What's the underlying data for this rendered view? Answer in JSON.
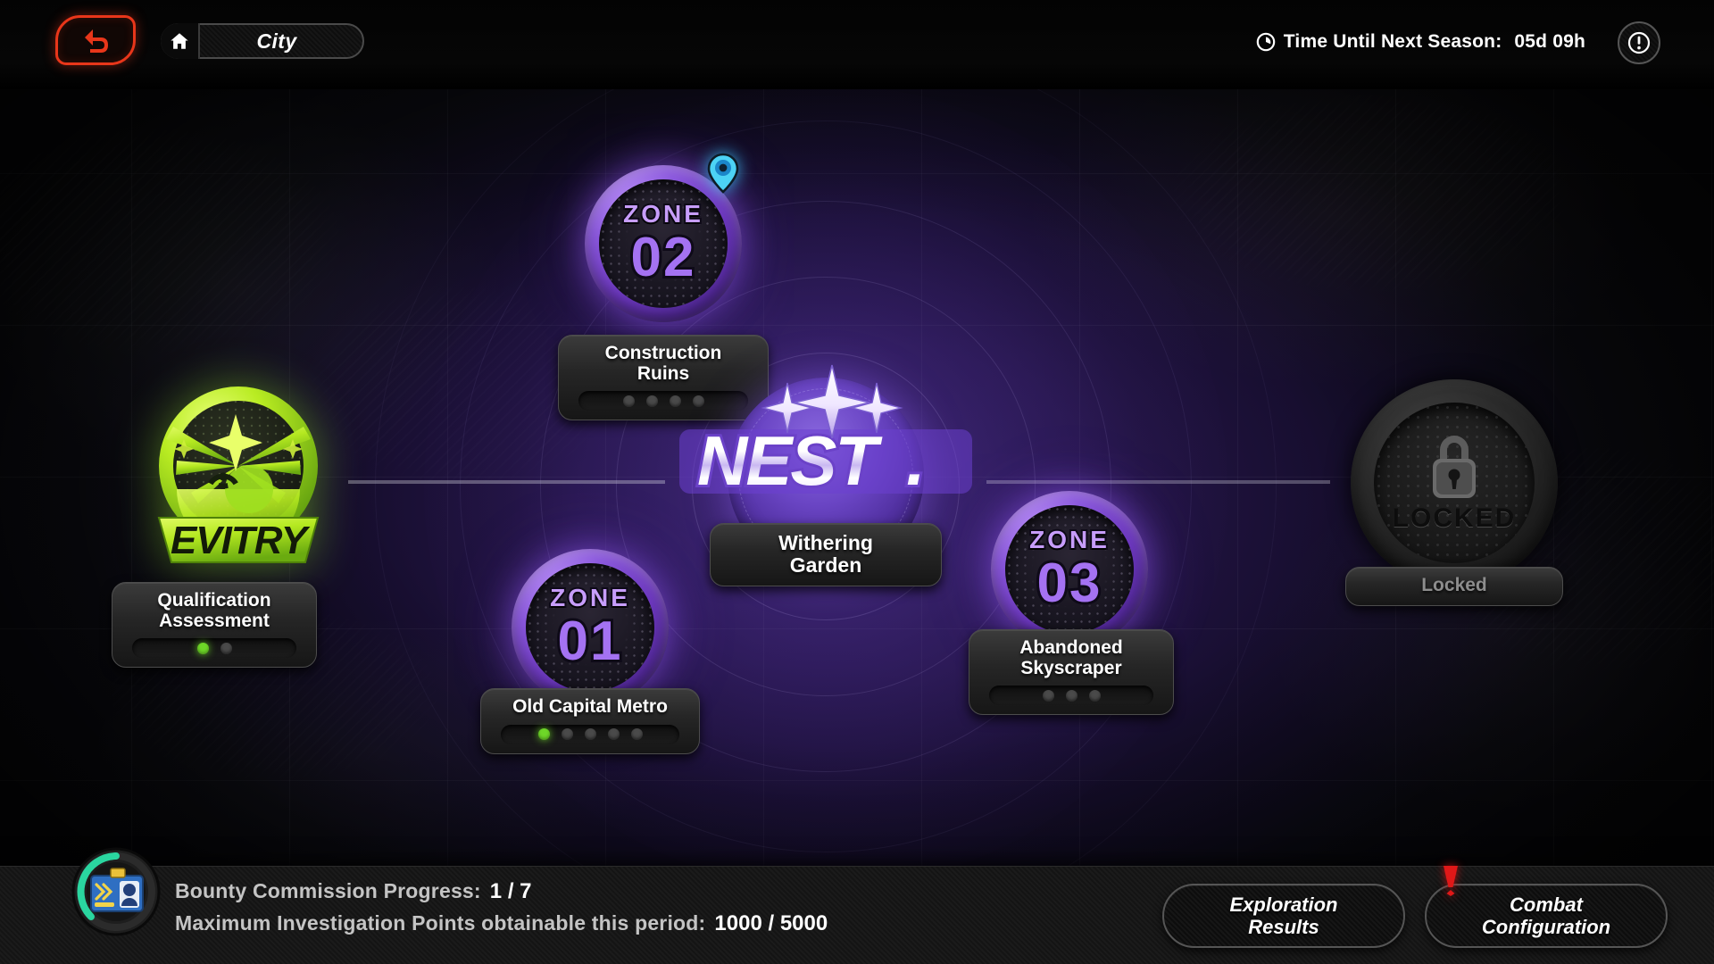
{
  "header": {
    "back_icon": "back-arrow-icon",
    "home_icon": "home-icon",
    "breadcrumb_label": "City",
    "clock_icon": "clock-icon",
    "season_label": "Time Until Next Season:",
    "season_value": "05d 09h",
    "info_icon": "info-icon"
  },
  "map": {
    "nodes": [
      {
        "id": "qualification",
        "type": "qualification",
        "badge_text": "EVITRY",
        "label": "Qualification\nAssessment",
        "label_line1": "Qualification",
        "label_line2": "Assessment",
        "dots_total": 2,
        "dots_filled": 1,
        "accent": "#b4e820",
        "locked": false
      },
      {
        "id": "zone-02",
        "type": "zone",
        "zone_word": "ZONE",
        "zone_number": "02",
        "label_line1": "Construction",
        "label_line2": "Ruins",
        "dots_total": 4,
        "dots_filled": 0,
        "accent": "#8a57dd",
        "marker": "location-pin",
        "locked": false
      },
      {
        "id": "zone-01",
        "type": "zone",
        "zone_word": "ZONE",
        "zone_number": "01",
        "label_line1": "Old Capital Metro",
        "label_line2": "",
        "dots_total": 5,
        "dots_filled": 1,
        "accent": "#8a57dd",
        "locked": false
      },
      {
        "id": "zone-03",
        "type": "zone",
        "zone_word": "ZONE",
        "zone_number": "03",
        "label_line1": "Abandoned",
        "label_line2": "Skyscraper",
        "dots_total": 3,
        "dots_filled": 0,
        "accent": "#8a57dd",
        "locked": false
      },
      {
        "id": "nest",
        "type": "hub",
        "logo_text": "NEST",
        "logo_dot": ".",
        "label_line1": "Withering",
        "label_line2": "Garden",
        "accent": "#7a4ad8",
        "locked": false
      },
      {
        "id": "locked",
        "type": "locked",
        "badge_word": "LOCKED",
        "label_line1": "Locked",
        "label_line2": "",
        "lock_icon": "padlock-icon",
        "accent": "#555555",
        "locked": true
      }
    ]
  },
  "footer": {
    "bounty_icon": "bounty-commission-icon",
    "progress_label": "Bounty Commission Progress:",
    "progress_value": "1 / 7",
    "points_label": "Maximum Investigation Points obtainable this period:",
    "points_value": "1000 / 5000",
    "btn_exploration_line1": "Exploration",
    "btn_exploration_line2": "Results",
    "btn_combat_line1": "Combat",
    "btn_combat_line2": "Configuration",
    "alert_icon": "alert-exclamation-icon"
  },
  "colors": {
    "accent_purple": "#8a57dd",
    "accent_green": "#b4e820",
    "alert_red": "#e8361a",
    "pin_cyan": "#3ec8ff",
    "dot_on": "#6ed728"
  }
}
